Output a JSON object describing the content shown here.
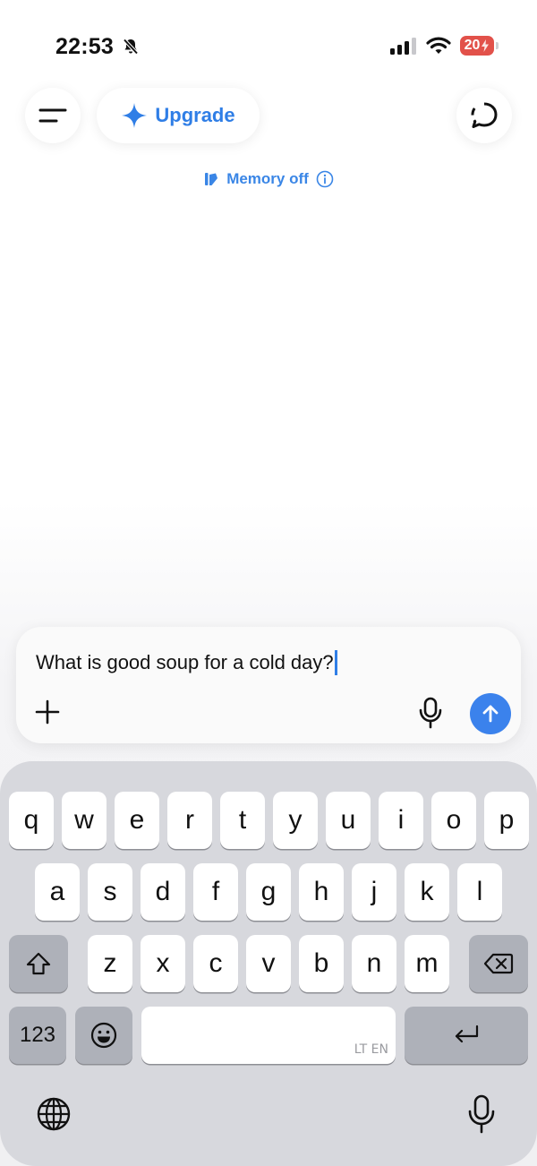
{
  "status_bar": {
    "time": "22:53",
    "battery": "20"
  },
  "header": {
    "upgrade_label": "Upgrade",
    "memory_label": "Memory off"
  },
  "composer": {
    "text": "What is good soup for a cold day?"
  },
  "keyboard": {
    "row1": [
      "q",
      "w",
      "e",
      "r",
      "t",
      "y",
      "u",
      "i",
      "o",
      "p"
    ],
    "row2": [
      "a",
      "s",
      "d",
      "f",
      "g",
      "h",
      "j",
      "k",
      "l"
    ],
    "row3": [
      "z",
      "x",
      "c",
      "v",
      "b",
      "n",
      "m"
    ],
    "numbers_label": "123",
    "space_language": "LT EN"
  },
  "colors": {
    "accent": "#2f7ee6",
    "send_button": "#3b82ec",
    "battery_low": "#e2514a",
    "keyboard_bg": "#d7d8dd"
  },
  "icons": {
    "menu": "menu-icon",
    "upgrade": "sparkle-icon",
    "new_chat": "chat-bubble-icon",
    "memory": "memory-icon",
    "info": "info-icon",
    "add": "plus-icon",
    "voice": "microphone-icon",
    "send": "arrow-up-icon",
    "shift": "shift-icon",
    "delete": "backspace-icon",
    "emoji": "emoji-icon",
    "return": "return-icon",
    "globe": "globe-icon"
  }
}
